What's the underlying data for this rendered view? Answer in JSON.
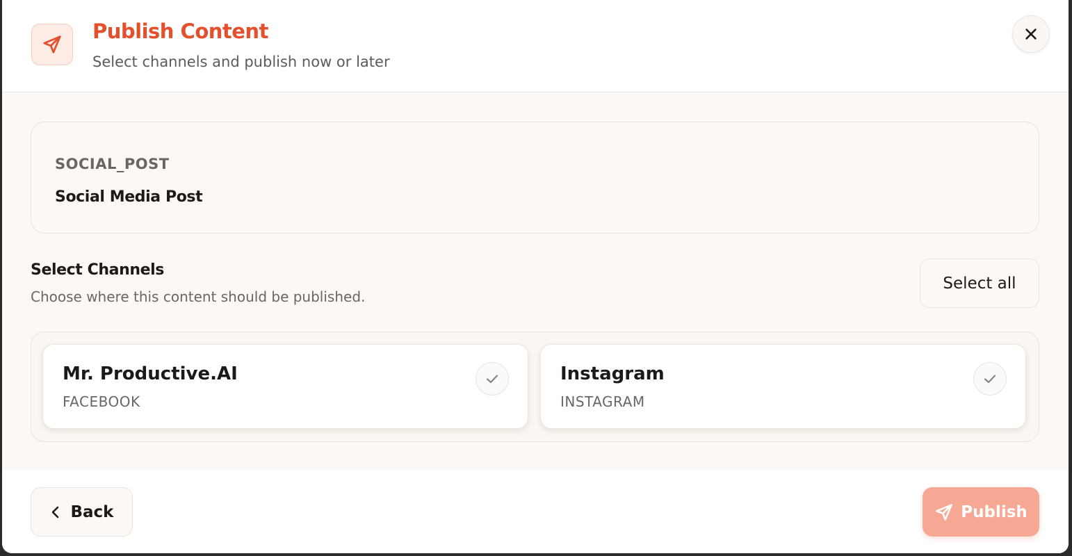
{
  "header": {
    "title": "Publish Content",
    "subtitle": "Select channels and publish now or later",
    "icon": "send-icon",
    "close_icon": "close-icon"
  },
  "content": {
    "type": "SOCIAL_POST",
    "name": "Social Media Post"
  },
  "channels_section": {
    "title": "Select Channels",
    "description": "Choose where this content should be published.",
    "select_all_label": "Select all",
    "channels": [
      {
        "name": "Mr. Productive.AI",
        "platform": "FACEBOOK",
        "selected": false
      },
      {
        "name": "Instagram",
        "platform": "INSTAGRAM",
        "selected": false
      }
    ]
  },
  "footer": {
    "back_label": "Back",
    "back_icon": "chevron-left-icon",
    "publish_label": "Publish",
    "publish_icon": "send-icon"
  },
  "colors": {
    "accent": "#e5502c",
    "publish_disabled": "#f6a895",
    "body_background": "#fcf8f5"
  }
}
